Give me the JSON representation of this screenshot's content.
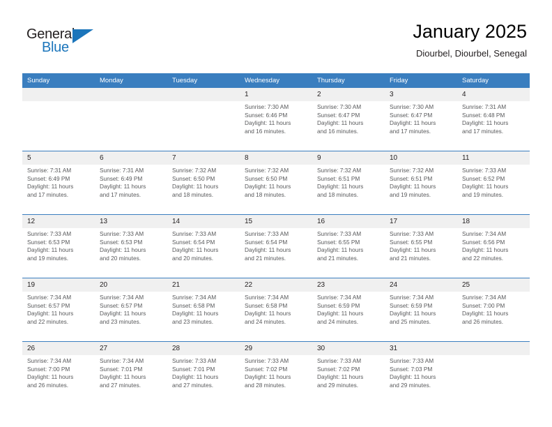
{
  "brand": {
    "name_part1": "General",
    "name_part2": "Blue",
    "triangle_color": "#1b75bb",
    "text_color": "#231f20"
  },
  "header": {
    "title": "January 2025",
    "location": "Diourbel, Diourbel, Senegal"
  },
  "theme": {
    "header_blue": "#3a7ebf",
    "daynum_band": "#f0f0f0",
    "body_text": "#58595b"
  },
  "weekdays": [
    "Sunday",
    "Monday",
    "Tuesday",
    "Wednesday",
    "Thursday",
    "Friday",
    "Saturday"
  ],
  "weeks": [
    {
      "days": [
        {
          "num": "",
          "lines": [
            "",
            "",
            "",
            ""
          ]
        },
        {
          "num": "",
          "lines": [
            "",
            "",
            "",
            ""
          ]
        },
        {
          "num": "",
          "lines": [
            "",
            "",
            "",
            ""
          ]
        },
        {
          "num": "1",
          "lines": [
            "Sunrise: 7:30 AM",
            "Sunset: 6:46 PM",
            "Daylight: 11 hours",
            "and 16 minutes."
          ]
        },
        {
          "num": "2",
          "lines": [
            "Sunrise: 7:30 AM",
            "Sunset: 6:47 PM",
            "Daylight: 11 hours",
            "and 16 minutes."
          ]
        },
        {
          "num": "3",
          "lines": [
            "Sunrise: 7:30 AM",
            "Sunset: 6:47 PM",
            "Daylight: 11 hours",
            "and 17 minutes."
          ]
        },
        {
          "num": "4",
          "lines": [
            "Sunrise: 7:31 AM",
            "Sunset: 6:48 PM",
            "Daylight: 11 hours",
            "and 17 minutes."
          ]
        }
      ]
    },
    {
      "days": [
        {
          "num": "5",
          "lines": [
            "Sunrise: 7:31 AM",
            "Sunset: 6:49 PM",
            "Daylight: 11 hours",
            "and 17 minutes."
          ]
        },
        {
          "num": "6",
          "lines": [
            "Sunrise: 7:31 AM",
            "Sunset: 6:49 PM",
            "Daylight: 11 hours",
            "and 17 minutes."
          ]
        },
        {
          "num": "7",
          "lines": [
            "Sunrise: 7:32 AM",
            "Sunset: 6:50 PM",
            "Daylight: 11 hours",
            "and 18 minutes."
          ]
        },
        {
          "num": "8",
          "lines": [
            "Sunrise: 7:32 AM",
            "Sunset: 6:50 PM",
            "Daylight: 11 hours",
            "and 18 minutes."
          ]
        },
        {
          "num": "9",
          "lines": [
            "Sunrise: 7:32 AM",
            "Sunset: 6:51 PM",
            "Daylight: 11 hours",
            "and 18 minutes."
          ]
        },
        {
          "num": "10",
          "lines": [
            "Sunrise: 7:32 AM",
            "Sunset: 6:51 PM",
            "Daylight: 11 hours",
            "and 19 minutes."
          ]
        },
        {
          "num": "11",
          "lines": [
            "Sunrise: 7:33 AM",
            "Sunset: 6:52 PM",
            "Daylight: 11 hours",
            "and 19 minutes."
          ]
        }
      ]
    },
    {
      "days": [
        {
          "num": "12",
          "lines": [
            "Sunrise: 7:33 AM",
            "Sunset: 6:53 PM",
            "Daylight: 11 hours",
            "and 19 minutes."
          ]
        },
        {
          "num": "13",
          "lines": [
            "Sunrise: 7:33 AM",
            "Sunset: 6:53 PM",
            "Daylight: 11 hours",
            "and 20 minutes."
          ]
        },
        {
          "num": "14",
          "lines": [
            "Sunrise: 7:33 AM",
            "Sunset: 6:54 PM",
            "Daylight: 11 hours",
            "and 20 minutes."
          ]
        },
        {
          "num": "15",
          "lines": [
            "Sunrise: 7:33 AM",
            "Sunset: 6:54 PM",
            "Daylight: 11 hours",
            "and 21 minutes."
          ]
        },
        {
          "num": "16",
          "lines": [
            "Sunrise: 7:33 AM",
            "Sunset: 6:55 PM",
            "Daylight: 11 hours",
            "and 21 minutes."
          ]
        },
        {
          "num": "17",
          "lines": [
            "Sunrise: 7:33 AM",
            "Sunset: 6:55 PM",
            "Daylight: 11 hours",
            "and 21 minutes."
          ]
        },
        {
          "num": "18",
          "lines": [
            "Sunrise: 7:34 AM",
            "Sunset: 6:56 PM",
            "Daylight: 11 hours",
            "and 22 minutes."
          ]
        }
      ]
    },
    {
      "days": [
        {
          "num": "19",
          "lines": [
            "Sunrise: 7:34 AM",
            "Sunset: 6:57 PM",
            "Daylight: 11 hours",
            "and 22 minutes."
          ]
        },
        {
          "num": "20",
          "lines": [
            "Sunrise: 7:34 AM",
            "Sunset: 6:57 PM",
            "Daylight: 11 hours",
            "and 23 minutes."
          ]
        },
        {
          "num": "21",
          "lines": [
            "Sunrise: 7:34 AM",
            "Sunset: 6:58 PM",
            "Daylight: 11 hours",
            "and 23 minutes."
          ]
        },
        {
          "num": "22",
          "lines": [
            "Sunrise: 7:34 AM",
            "Sunset: 6:58 PM",
            "Daylight: 11 hours",
            "and 24 minutes."
          ]
        },
        {
          "num": "23",
          "lines": [
            "Sunrise: 7:34 AM",
            "Sunset: 6:59 PM",
            "Daylight: 11 hours",
            "and 24 minutes."
          ]
        },
        {
          "num": "24",
          "lines": [
            "Sunrise: 7:34 AM",
            "Sunset: 6:59 PM",
            "Daylight: 11 hours",
            "and 25 minutes."
          ]
        },
        {
          "num": "25",
          "lines": [
            "Sunrise: 7:34 AM",
            "Sunset: 7:00 PM",
            "Daylight: 11 hours",
            "and 26 minutes."
          ]
        }
      ]
    },
    {
      "days": [
        {
          "num": "26",
          "lines": [
            "Sunrise: 7:34 AM",
            "Sunset: 7:00 PM",
            "Daylight: 11 hours",
            "and 26 minutes."
          ]
        },
        {
          "num": "27",
          "lines": [
            "Sunrise: 7:34 AM",
            "Sunset: 7:01 PM",
            "Daylight: 11 hours",
            "and 27 minutes."
          ]
        },
        {
          "num": "28",
          "lines": [
            "Sunrise: 7:33 AM",
            "Sunset: 7:01 PM",
            "Daylight: 11 hours",
            "and 27 minutes."
          ]
        },
        {
          "num": "29",
          "lines": [
            "Sunrise: 7:33 AM",
            "Sunset: 7:02 PM",
            "Daylight: 11 hours",
            "and 28 minutes."
          ]
        },
        {
          "num": "30",
          "lines": [
            "Sunrise: 7:33 AM",
            "Sunset: 7:02 PM",
            "Daylight: 11 hours",
            "and 29 minutes."
          ]
        },
        {
          "num": "31",
          "lines": [
            "Sunrise: 7:33 AM",
            "Sunset: 7:03 PM",
            "Daylight: 11 hours",
            "and 29 minutes."
          ]
        },
        {
          "num": "",
          "lines": [
            "",
            "",
            "",
            ""
          ]
        }
      ]
    }
  ]
}
